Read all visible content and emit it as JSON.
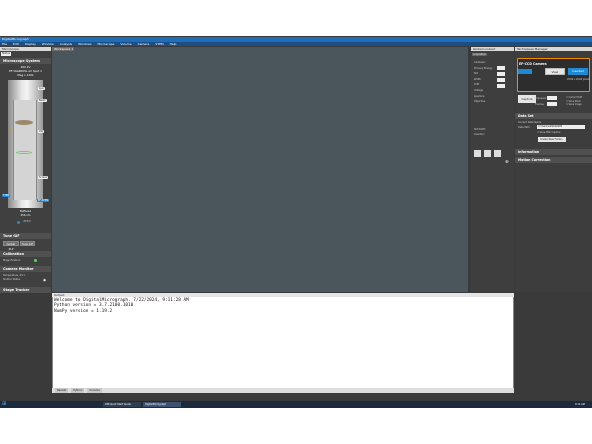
{
  "window": {
    "title": "DigitalMicrograph"
  },
  "menu": [
    "File",
    "Edit",
    "Display",
    "Window",
    "Analysis",
    "Windows",
    "Microscope",
    "Volume",
    "Camera",
    "STEM",
    "Help"
  ],
  "left_panel": {
    "header": "Microscope",
    "tab": "Status",
    "microscope_system": {
      "title": "Microscope System",
      "line1": "200 kV",
      "line2": "EF-YAG600SL eV Spot 1",
      "line3": "Mag x 120k",
      "tags": [
        "Gun",
        "Beam",
        "Obj",
        "Screen"
      ],
      "label_ef": "EF-STEM",
      "label_ftem": "FTEM",
      "label_holder": "Holder",
      "lower_mag": "Buffered",
      "lower_val": "256 nm",
      "lower_status": "ZERO"
    },
    "tune_gif": {
      "title": "Tune GIF",
      "btn1": "Center ZLP",
      "btn2": "Tune GIF"
    },
    "calibration": {
      "title": "Calibration",
      "row": "Magnification"
    },
    "camera_monitor": {
      "title": "Camera Monitor",
      "row1": "Temperature  -25 C",
      "row2": "Shutter Status"
    },
    "stage_tracker": {
      "title": "Stage Tracker"
    }
  },
  "workspace": {
    "tab": "Workspace 1"
  },
  "mid_panel": {
    "header": "Global Lookout",
    "tabs": [
      "Slit",
      "Shutter",
      "Acquisition"
    ],
    "fields": [
      "Cartesian",
      "Primary Energy",
      "Slit",
      "Width",
      "Drift",
      "Voltage",
      "Aperture",
      "Objective"
    ],
    "status1": "Slit Width",
    "status2": "Insertion"
  },
  "right_panel": {
    "header": "Techniques Manager",
    "camera": {
      "title": "EF-CCD Camera",
      "view_label": "View",
      "inserted_label": "Inserted",
      "size": "2048 x 2048 pixels"
    },
    "capture": {
      "button": "Capture",
      "exposure_label": "Exposure",
      "frames_label": "Frames",
      "chk1": "Correct Drift",
      "chk2": "Save Stack",
      "chk3": "Save Image"
    },
    "data_set": {
      "title": "Data Set",
      "current_label": "Current Data Name",
      "data_path_label": "Data Path",
      "data_path": "C:\\Users\\Lab\\Data\\DM",
      "chk": "Save After Capture",
      "button": "Create New Folder..."
    },
    "information": "Information",
    "motion_correction": "Motion Correction"
  },
  "output": {
    "header": "Output",
    "lines": [
      "Welcome to DigitalMicrograph. 7/22/2024, 9:11:28 AM",
      "Python version = 3.7.2100.1010",
      "NumPy version = 1.19.2"
    ],
    "tabs": [
      "Results",
      "Python",
      "Console"
    ]
  },
  "taskbar": {
    "items": [
      "DM Quick Start Guide",
      "DigitalMicrograph"
    ],
    "time": "9:14 AM"
  }
}
